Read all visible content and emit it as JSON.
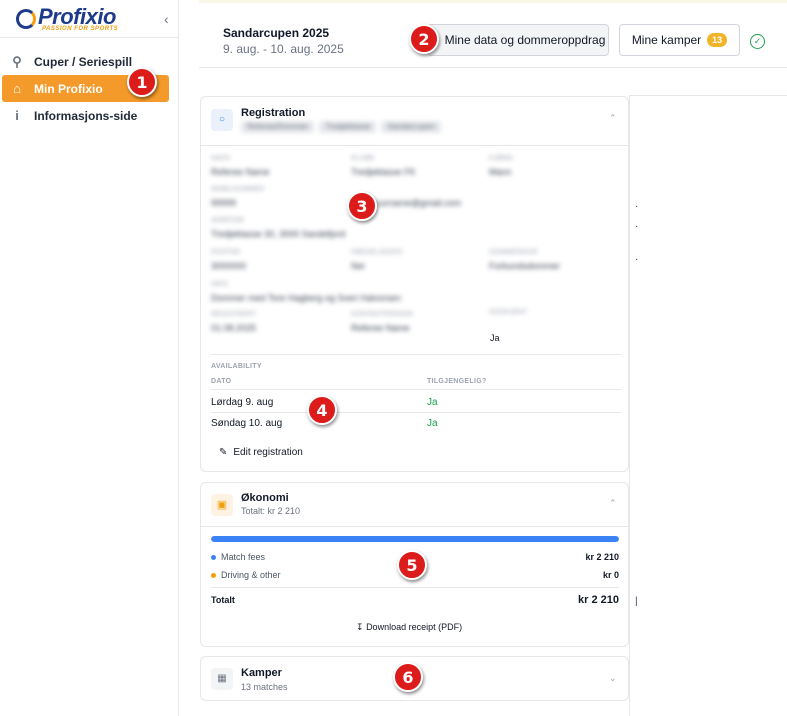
{
  "brand": {
    "name": "Profixio",
    "tagline": "PASSION FOR SPORTS"
  },
  "sidebar": {
    "items": [
      {
        "label": "Cuper / Seriespill",
        "icon": "search-icon",
        "active": false
      },
      {
        "label": "Min Profixio",
        "icon": "home-icon",
        "active": true
      },
      {
        "label": "Informasjons-side",
        "icon": "info-icon",
        "active": false
      }
    ]
  },
  "header": {
    "event_title": "Sandarcupen 2025",
    "event_dates": "9. aug. - 10. aug. 2025",
    "btn_data": "Mine data og dommeroppdrag",
    "btn_kamper": "Mine kamper",
    "kamper_count": "13"
  },
  "registration": {
    "title": "Registration",
    "pills": [
      "Referee/Dommer",
      "Tredjeklasse",
      "Sandarcupen"
    ],
    "fields": [
      {
        "label": "Navn",
        "value": "Referee Name"
      },
      {
        "label": "Klubb",
        "value": "Tredjeklasse FK"
      },
      {
        "label": "Kjønn",
        "value": "Mann"
      },
      {
        "label": "Mobilnummer",
        "value": "99999"
      },
      {
        "label": "E-post",
        "value": "name.surname@gmail.com"
      },
      {
        "label": "Adresse",
        "value": "Tredjeklasse 30, 3000 Sandefjord"
      },
      {
        "label": "Postnr",
        "value": "3000000"
      },
      {
        "label": "Fødselsdato",
        "value": "Nei"
      },
      {
        "label": "Dommernivå",
        "value": "Forbundsdommer"
      },
      {
        "label": "Info",
        "value": "Dommer med Tore Hagberg og Sveri Halvorsen"
      },
      {
        "label": "Registrert",
        "value": "01.08.2025"
      },
      {
        "label": "Kontaktperson",
        "value": "Referee Name"
      },
      {
        "label": "Godkjent",
        "value": ""
      }
    ],
    "visible_value": "Ja",
    "availability_title": "AVAILABILITY",
    "col_date": "DATO",
    "col_avail": "TILGJENGELIG?",
    "days": [
      {
        "date": "Lørdag 9. aug",
        "available": "Ja"
      },
      {
        "date": "Søndag 10. aug",
        "available": "Ja"
      }
    ],
    "edit_label": "Edit registration"
  },
  "okonomi": {
    "title": "Økonomi",
    "subtitle": "Totalt: kr 2 210",
    "progress_fraction": 1.0,
    "rows": [
      {
        "label": "Match fees",
        "amount": "kr 2 210",
        "color": "#3b82f6"
      },
      {
        "label": "Driving & other",
        "amount": "kr 0",
        "color": "#f59e0b"
      }
    ],
    "total_label": "Totalt",
    "total_amount": "kr 2 210",
    "download_label": "Download receipt (PDF)"
  },
  "kamper": {
    "title": "Kamper",
    "subtitle": "13 matches"
  },
  "steps": [
    "1",
    "2",
    "3",
    "4",
    "5",
    "6"
  ],
  "colors": {
    "accent": "#f39a2a",
    "brand": "#1e3a8a",
    "step": "#dc1b1b",
    "ok": "#16a34a"
  }
}
